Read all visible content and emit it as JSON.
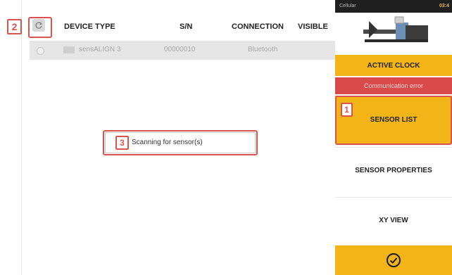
{
  "table": {
    "headers": {
      "device_type": "DEVICE TYPE",
      "sn": "S/N",
      "connection": "CONNECTION",
      "visible": "VISIBLE"
    },
    "rows": [
      {
        "device_type": "sensALIGN 3",
        "sn": "00000010",
        "connection": "Bluetooth",
        "visible": ""
      }
    ]
  },
  "scan": {
    "text": "Scanning for sensor(s)"
  },
  "callouts": {
    "one": "1",
    "two": "2",
    "three": "3"
  },
  "sidebar": {
    "status_left": "Cellular",
    "status_right": "03:4",
    "active_clock": "ACTIVE CLOCK",
    "comm_error": "Communication error",
    "sensor_list": "SENSOR LIST",
    "sensor_properties": "SENSOR PROPERTIES",
    "xy_view": "XY VIEW"
  },
  "icons": {
    "refresh": "refresh-icon",
    "confirm": "check-circle-icon",
    "machine": "machine-train-icon"
  },
  "colors": {
    "accent_yellow": "#f3b418",
    "error_red": "#d94a4a",
    "callout_red": "#d9534f"
  }
}
